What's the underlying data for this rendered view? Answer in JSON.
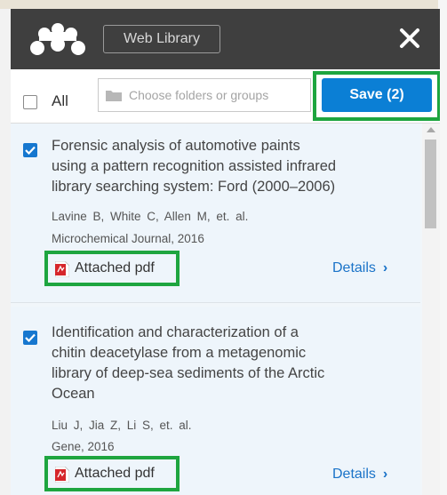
{
  "header": {
    "web_library_label": "Web Library"
  },
  "toolbar": {
    "all_label": "All",
    "folder_placeholder": "Choose folders or groups",
    "save_label": "Save (2)"
  },
  "items": [
    {
      "checked": true,
      "title_lines": [
        "Forensic analysis of automotive paints",
        "using a pattern recognition assisted infrared",
        "library searching system: Ford (2000–2006)"
      ],
      "authors": "Lavine B,  White C,  Allen M,  et. al.",
      "publication": "Microchemical Journal, 2016",
      "attachment": "Attached pdf",
      "details": "Details"
    },
    {
      "checked": true,
      "title_lines": [
        "Identification and characterization of a",
        "chitin deacetylase from a metagenomic",
        "library of deep-sea sediments of the Arctic",
        "Ocean"
      ],
      "authors": "Liu J,  Jia Z,  Li S,  et. al.",
      "publication": "Gene, 2016",
      "attachment": "Attached pdf",
      "details": "Details"
    }
  ],
  "colors": {
    "header_bg": "#3f3f3f",
    "save_button": "#0b7fd5",
    "highlight": "#1ea53f",
    "link": "#1a73c8"
  },
  "icons": [
    "mendeley-logo-icon",
    "close-icon",
    "folder-icon",
    "pdf-icon",
    "checkbox-checked-icon",
    "chevron-right-icon"
  ]
}
